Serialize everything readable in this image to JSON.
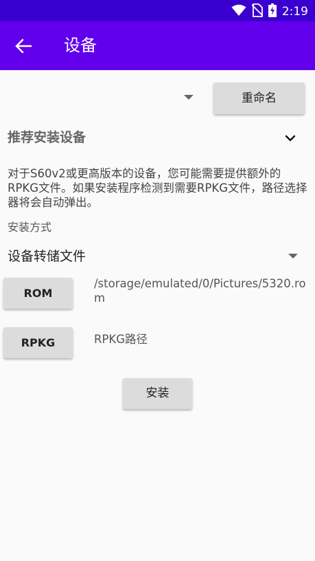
{
  "status_bar": {
    "time": "2:19",
    "icons": [
      "wifi-icon",
      "no-sim-icon",
      "battery-charging-icon"
    ]
  },
  "app_bar": {
    "title": "设备",
    "back_icon": "arrow-back-icon"
  },
  "device_selector": {
    "rename_label": "重命名"
  },
  "recommendation": {
    "title": "推荐安装设备",
    "description": "对于S60v2或更高版本的设备，您可能需要提供额外的RPKG文件。如果安装程序检测到需要RPKG文件，路径选择器将会自动弹出。"
  },
  "install_method": {
    "label": "安装方式",
    "selected": "设备转储文件"
  },
  "rom": {
    "button_label": "ROM",
    "path": "/storage/emulated/0/Pictures/5320.rom"
  },
  "rpkg": {
    "button_label": "RPKG",
    "path_placeholder": "RPKG路径"
  },
  "install": {
    "button_label": "安装"
  },
  "colors": {
    "app_bar": "#6200ee",
    "status_bar": "#3a00cf",
    "button_bg": "#dcdcdc",
    "page_bg": "#fafafa"
  }
}
